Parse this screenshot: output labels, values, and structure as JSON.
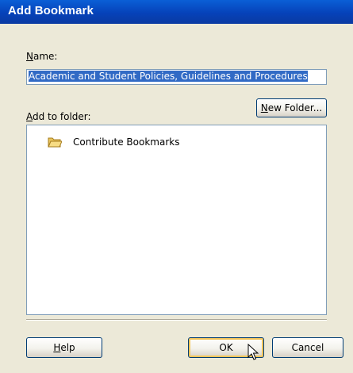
{
  "window": {
    "title": "Add Bookmark"
  },
  "name": {
    "label_prefix": "",
    "label_accel": "N",
    "label_rest": "ame:",
    "value": "Academic and Student Policies, Guidelines and Procedures"
  },
  "folder": {
    "label_accel": "A",
    "label_rest": "dd to folder:",
    "new_folder_accel": "N",
    "new_folder_rest": "ew Folder...",
    "items": [
      {
        "label": "Contribute Bookmarks",
        "icon": "folder-open-icon"
      }
    ]
  },
  "buttons": {
    "help_accel": "H",
    "help_rest": "elp",
    "ok": "OK",
    "cancel": "Cancel"
  },
  "colors": {
    "titlebar": "#0642b9",
    "selection": "#316ac5",
    "background": "#ece9d8"
  }
}
